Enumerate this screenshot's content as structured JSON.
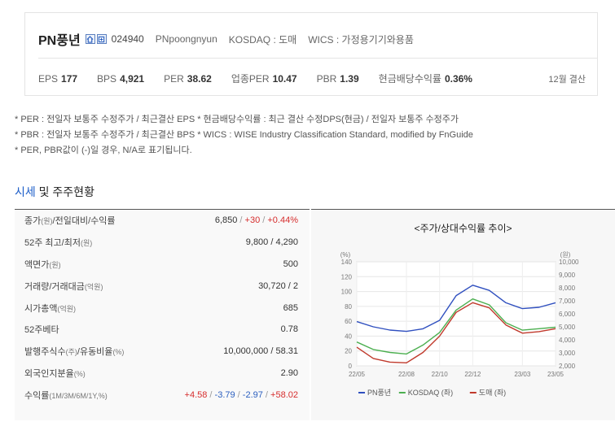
{
  "header": {
    "name": "PN풍년",
    "code": "024940",
    "english_name": "PNpoongnyun",
    "market": "KOSDAQ : 도매",
    "wics": "WICS : 가정용기기와용품",
    "metrics": [
      {
        "label": "EPS",
        "value": "177"
      },
      {
        "label": "BPS",
        "value": "4,921"
      },
      {
        "label": "PER",
        "value": "38.62"
      },
      {
        "label": "업종PER",
        "value": "10.47"
      },
      {
        "label": "PBR",
        "value": "1.39"
      },
      {
        "label": "현금배당수익률",
        "value": "0.36%"
      }
    ],
    "settlement": "12월 결산"
  },
  "notes": [
    "* PER : 전일자 보통주 수정주가 / 최근결산 EPS * 현금배당수익률 : 최근 결산 수정DPS(현금) / 전일자 보통주 수정주가",
    "* PBR : 전일자 보통주 수정주가 / 최근결산 BPS * WICS : WISE Industry Classification Standard, modified by FnGuide",
    "* PER, PBR값이 (-)일 경우, N/A로 표기됩니다."
  ],
  "section": {
    "title_accent": "시세",
    "title_rest": " 및 주주현황"
  },
  "stats": [
    {
      "label": "종가",
      "unit": "(원)",
      "label2": "/전일대비/수익률",
      "v1": "6,850",
      "v2": "+30",
      "v3": "+0.44%"
    },
    {
      "label": "52주 최고/최저",
      "unit": "(원)",
      "value": "9,800 / 4,290"
    },
    {
      "label": "액면가",
      "unit": "(원)",
      "value": "500"
    },
    {
      "label": "거래량/거래대금",
      "unit": "(억원)",
      "value": "30,720 / 2"
    },
    {
      "label": "시가총액",
      "unit": "(억원)",
      "value": "685"
    },
    {
      "label": "52주베타",
      "unit": "",
      "value": "0.78"
    },
    {
      "label": "발행주식수",
      "unit": "(주)",
      "label2": "/유동비율",
      "unit2": "(%)",
      "value": "10,000,000 / 58.31"
    },
    {
      "label": "외국인지분율",
      "unit": "(%)",
      "value": "2.90"
    },
    {
      "label": "수익률",
      "unit": "(1M/3M/6M/1Y,%)",
      "r1": "+4.58",
      "r2": "-3.79",
      "r3": "-2.97",
      "r4": "+58.02"
    }
  ],
  "chart_title": "<주가/상대수익률 추이>",
  "chart_data": {
    "type": "line",
    "x": [
      "22/05",
      "22/06",
      "22/07",
      "22/08",
      "22/09",
      "22/10",
      "22/11",
      "22/12",
      "23/01",
      "23/02",
      "23/03",
      "23/04",
      "23/05"
    ],
    "x_ticks": [
      "22/05",
      "22/08",
      "22/10",
      "22/12",
      "23/03",
      "23/05"
    ],
    "left_axis": {
      "unit": "(%)",
      "range": [
        0,
        140
      ],
      "ticks": [
        0,
        20,
        40,
        60,
        80,
        100,
        120,
        140
      ]
    },
    "right_axis": {
      "unit": "(원)",
      "range": [
        2000,
        10000
      ],
      "ticks": [
        "2,000",
        "3,000",
        "4,000",
        "5,000",
        "6,000",
        "7,000",
        "8,000",
        "9,000",
        "10,000"
      ]
    },
    "series": [
      {
        "name": "PN풍년",
        "axis": "right",
        "color": "#2f4fbf",
        "values": [
          5400,
          5000,
          4750,
          4650,
          4850,
          5500,
          7400,
          8200,
          7800,
          6850,
          6400,
          6500,
          6850
        ]
      },
      {
        "name": "KOSDAQ (좌)",
        "axis": "left",
        "color": "#4caf50",
        "values": [
          32,
          22,
          18,
          16,
          28,
          45,
          75,
          90,
          82,
          58,
          48,
          50,
          52
        ]
      },
      {
        "name": "도매 (좌)",
        "axis": "left",
        "color": "#c0392b",
        "values": [
          25,
          10,
          5,
          4,
          18,
          40,
          72,
          85,
          78,
          55,
          44,
          46,
          50
        ]
      }
    ]
  },
  "colors": {
    "accent": "#1a5cc8",
    "up": "#d62d2d",
    "down": "#2b5fbf"
  },
  "icons": [
    "home-icon",
    "info-icon"
  ]
}
